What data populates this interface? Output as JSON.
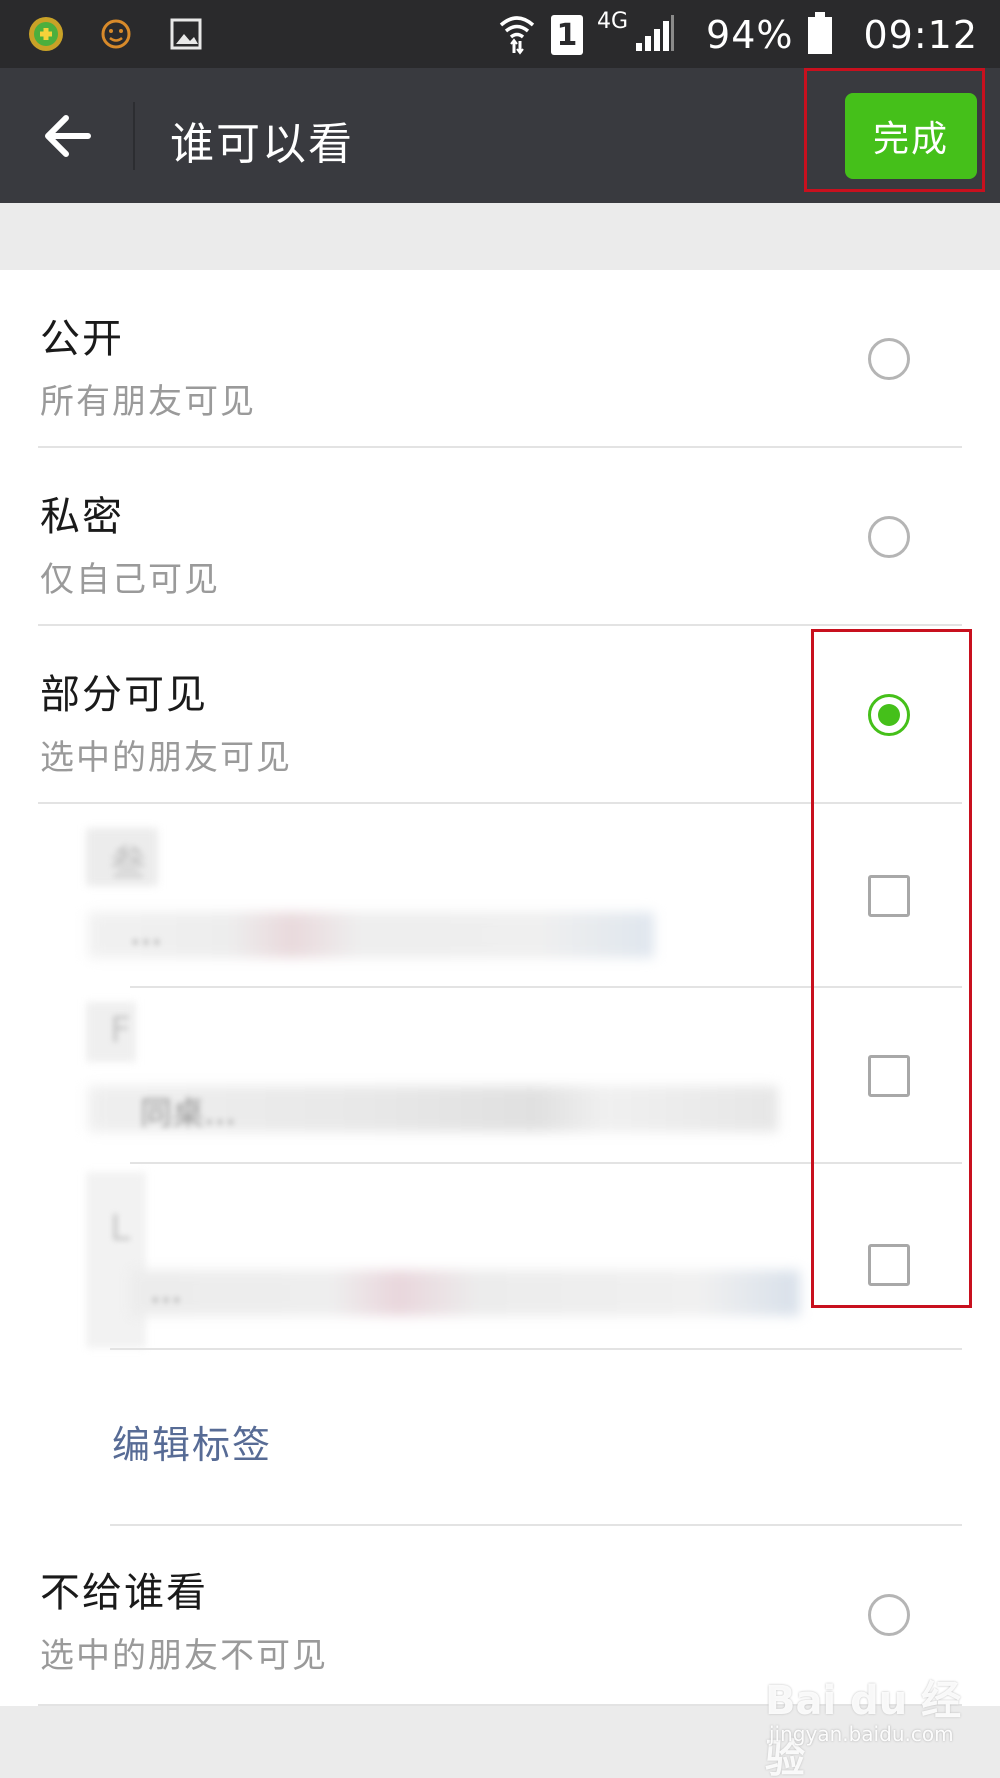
{
  "status_bar": {
    "battery": "94%",
    "time": "09:12",
    "network": "4G",
    "sim": "1",
    "icons": [
      "qihoo-360-icon",
      "face-icon",
      "image-icon",
      "wifi-icon",
      "sim-icon",
      "signal-icon",
      "battery-icon"
    ]
  },
  "title_bar": {
    "title": "谁可以看",
    "done_label": "完成"
  },
  "options": [
    {
      "title": "公开",
      "subtitle": "所有朋友可见",
      "selected": false
    },
    {
      "title": "私密",
      "subtitle": "仅自己可见",
      "selected": false
    },
    {
      "title": "部分可见",
      "subtitle": "选中的朋友可见",
      "selected": true
    },
    {
      "title": "不给谁看",
      "subtitle": "选中的朋友不可见",
      "selected": false
    }
  ],
  "tags": [
    {
      "name": "叁",
      "members": "…",
      "checked": false
    },
    {
      "name": "F",
      "members": "同桌…",
      "checked": false
    },
    {
      "name": "L",
      "members": "…",
      "checked": false
    }
  ],
  "edit_tags_label": "编辑标签",
  "watermark": {
    "logo": "Bai du 经验",
    "url": "jingyan.baidu.com"
  },
  "colors": {
    "accent_green": "#45c01a",
    "title_bar": "#393a3f",
    "status_bar": "#2a2a2c",
    "link_blue": "#576b95",
    "highlight_red": "#c8101e"
  }
}
